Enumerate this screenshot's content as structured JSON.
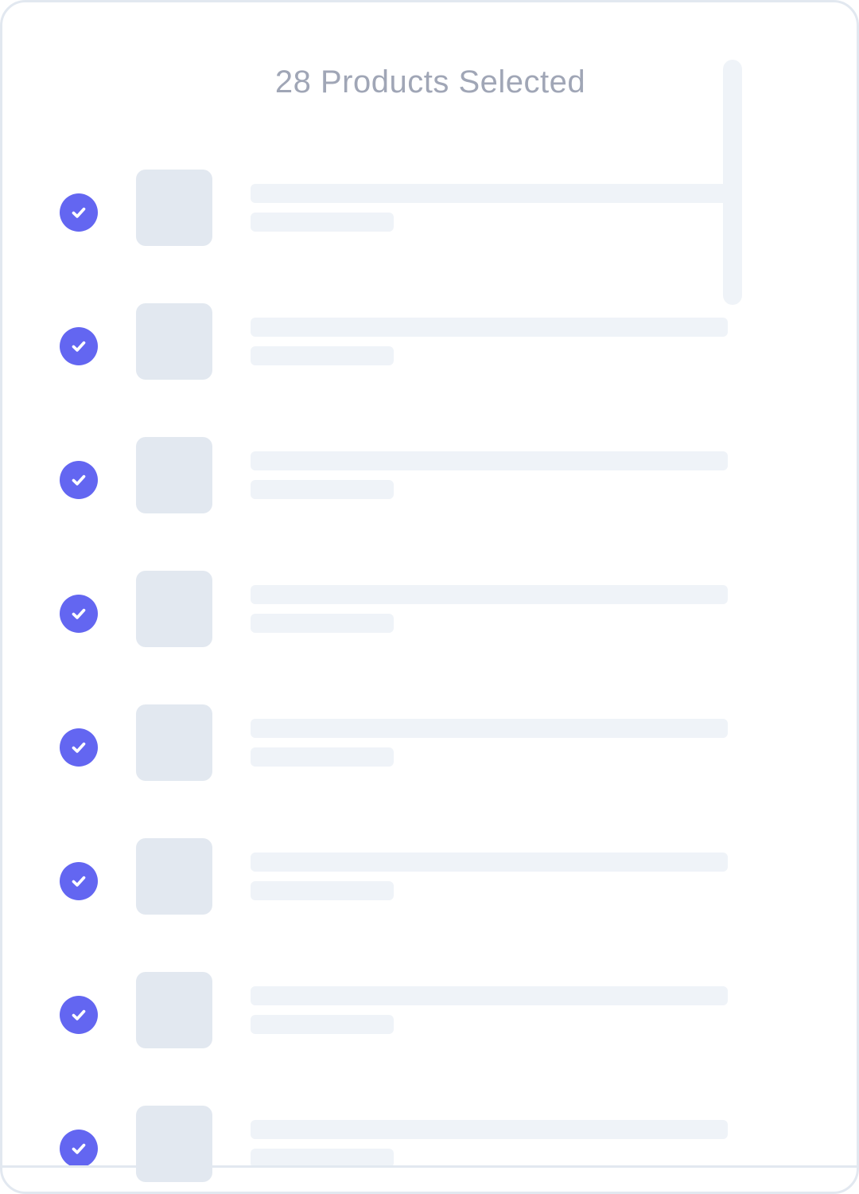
{
  "header": {
    "title": "28 Products Selected",
    "selected_count": 28
  },
  "theme": {
    "accent": "#6366f1",
    "skeleton_image": "#e2e8f0",
    "skeleton_text": "#eff3f8",
    "title_color": "#a0a6b6",
    "border": "#e2e8f0"
  },
  "list": {
    "items": [
      {
        "selected": true,
        "icon": "check-circle-icon",
        "state": "loading-placeholder"
      },
      {
        "selected": true,
        "icon": "check-circle-icon",
        "state": "loading-placeholder"
      },
      {
        "selected": true,
        "icon": "check-circle-icon",
        "state": "loading-placeholder"
      },
      {
        "selected": true,
        "icon": "check-circle-icon",
        "state": "loading-placeholder"
      },
      {
        "selected": true,
        "icon": "check-circle-icon",
        "state": "loading-placeholder"
      },
      {
        "selected": true,
        "icon": "check-circle-icon",
        "state": "loading-placeholder"
      },
      {
        "selected": true,
        "icon": "check-circle-icon",
        "state": "loading-placeholder"
      },
      {
        "selected": true,
        "icon": "check-circle-icon",
        "state": "loading-placeholder"
      }
    ]
  }
}
